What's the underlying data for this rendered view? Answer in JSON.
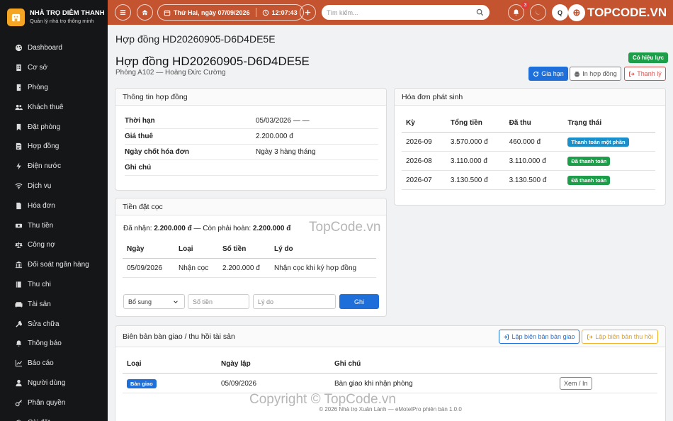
{
  "brand": {
    "name": "NHÀ TRỌ DIỄM THANH",
    "tagline": "Quản lý nhà trọ thông minh"
  },
  "nav": [
    {
      "label": "Dashboard",
      "icon": "palette-icon"
    },
    {
      "label": "Cơ sở",
      "icon": "building-icon"
    },
    {
      "label": "Phòng",
      "icon": "door-icon"
    },
    {
      "label": "Khách thuê",
      "icon": "users-icon"
    },
    {
      "label": "Đặt phòng",
      "icon": "bookmark-icon"
    },
    {
      "label": "Hợp đồng",
      "icon": "contract-icon"
    },
    {
      "label": "Điện nước",
      "icon": "bolt-icon"
    },
    {
      "label": "Dịch vụ",
      "icon": "wifi-icon"
    },
    {
      "label": "Hóa đơn",
      "icon": "file-icon"
    },
    {
      "label": "Thu tiền",
      "icon": "money-icon"
    },
    {
      "label": "Công nợ",
      "icon": "balance-icon"
    },
    {
      "label": "Đối soát ngân hàng",
      "icon": "bank-icon"
    },
    {
      "label": "Thu chi",
      "icon": "book-icon"
    },
    {
      "label": "Tài sản",
      "icon": "couch-icon"
    },
    {
      "label": "Sửa chữa",
      "icon": "tools-icon"
    },
    {
      "label": "Thông báo",
      "icon": "bell-icon"
    },
    {
      "label": "Báo cáo",
      "icon": "chart-icon"
    },
    {
      "label": "Người dùng",
      "icon": "user-icon"
    },
    {
      "label": "Phân quyền",
      "icon": "key-icon"
    },
    {
      "label": "Cài đặt",
      "icon": "gear-icon"
    }
  ],
  "topbar": {
    "date": "Thứ Hai, ngày 07/09/2026",
    "time": "12:07:43",
    "search_placeholder": "Tìm kiếm...",
    "notif_count": "3",
    "avatar_letter": "Q",
    "colors": {
      "topbar": "#c4532f"
    }
  },
  "page": {
    "breadcrumb": "Hợp đồng HD20260905-D6D4DE5E",
    "title": "Hợp đồng HD20260905-D6D4DE5E",
    "subtitle": "Phòng A102 — Hoàng Đức Cường",
    "status": "Có hiệu lực"
  },
  "actions": {
    "extend": "Gia hạn",
    "print": "In hợp đồng",
    "terminate": "Thanh lý"
  },
  "contract_info": {
    "title": "Thông tin hợp đồng",
    "rows": [
      {
        "k": "Thời hạn",
        "v": "05/03/2026 — —"
      },
      {
        "k": "Giá thuê",
        "v": "2.200.000 đ"
      },
      {
        "k": "Ngày chốt hóa đơn",
        "v": "Ngày 3 hàng tháng"
      },
      {
        "k": "Ghi chú",
        "v": ""
      }
    ]
  },
  "invoices": {
    "title": "Hóa đơn phát sinh",
    "headers": [
      "Kỳ",
      "Tổng tiền",
      "Đã thu",
      "Trạng thái"
    ],
    "rows": [
      {
        "period": "2026-09",
        "total": "3.570.000 đ",
        "paid": "460.000 đ",
        "status": "Thanh toán một phần",
        "color": "#1a8fc9"
      },
      {
        "period": "2026-08",
        "total": "3.110.000 đ",
        "paid": "3.110.000 đ",
        "status": "Đã thanh toán",
        "color": "#1e9e4a"
      },
      {
        "period": "2026-07",
        "total": "3.130.500 đ",
        "paid": "3.130.500 đ",
        "status": "Đã thanh toán",
        "color": "#1e9e4a"
      }
    ]
  },
  "deposit": {
    "title": "Tiền đặt cọc",
    "received_label": "Đã nhận:",
    "received": "2.200.000 đ",
    "remain_label": "— Còn phải hoàn:",
    "remain": "2.200.000 đ",
    "headers": [
      "Ngày",
      "Loại",
      "Số tiền",
      "Lý do"
    ],
    "rows": [
      {
        "date": "05/09/2026",
        "type": "Nhận cọc",
        "amount": "2.200.000 đ",
        "reason": "Nhận cọc khi ký hợp đồng"
      }
    ],
    "form": {
      "type": "Bổ sung",
      "amount_ph": "Số tiền",
      "reason_ph": "Lý do",
      "submit": "Ghi"
    }
  },
  "handover": {
    "title": "Biên bản bàn giao / thu hồi tài sản",
    "btn_handover": "Lập biên bản bàn giao",
    "btn_recover": "Lập biên bản thu hồi",
    "headers": [
      "Loại",
      "Ngày lập",
      "Ghi chú"
    ],
    "rows": [
      {
        "type": "Bàn giao",
        "date": "05/09/2026",
        "note": "Bàn giao khi nhận phòng",
        "action": "Xem / In"
      }
    ]
  },
  "footer": "© 2026 Nhà trọ Xuân Lành — eMotelPro phiên bản 1.0.0",
  "watermark": {
    "logo": "TOPCODE.VN",
    "text1": "TopCode.vn",
    "text2": "Copyright © TopCode.vn"
  }
}
